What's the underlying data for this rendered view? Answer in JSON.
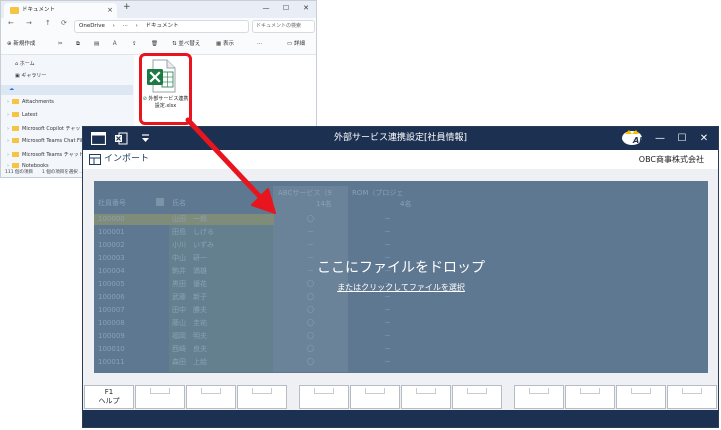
{
  "explorer": {
    "tab_title": "ドキュメント",
    "tab_close": "×",
    "new_tab": "+",
    "win_min": "—",
    "win_max": "☐",
    "win_close": "✕",
    "nav": {
      "back": "←",
      "forward": "→",
      "up": "↑",
      "refresh": "⟳"
    },
    "path": {
      "service": "OneDrive",
      "more": "···",
      "folder": "ドキュメント",
      "sep": "›"
    },
    "search_placeholder": "ドキュメントの検索",
    "toolbar": {
      "new": "新規作成",
      "sort": "並べ替え",
      "view": "表示",
      "details": "詳細"
    },
    "sidebar": [
      {
        "label": "ホーム"
      },
      {
        "label": "ギャラリー"
      },
      {
        "label": "Attachments"
      },
      {
        "label": "Latest"
      },
      {
        "label": "Microsoft Copilot チャット ファ"
      },
      {
        "label": "Microsoft Teams Chat Files"
      },
      {
        "label": "Microsoft Teams チャット ファ"
      },
      {
        "label": "Notebooks"
      }
    ],
    "status": "111 個の項目　　1 個の項目を選択 ...",
    "file": {
      "name": "外部サービス連携設定.xlsx",
      "icon": "excel-file-icon"
    }
  },
  "app": {
    "title": "外部サービス連携設定[社員情報]",
    "win_min": "—",
    "win_max": "☐",
    "win_close": "✕",
    "import_label": "インポート",
    "company": "OBC商事株式会社",
    "grid": {
      "headers": {
        "emp_no": "社員番号",
        "name": "氏名",
        "abc": "ABCサービス（9",
        "abc_count": "14名",
        "rom": "ROM（プロジェ",
        "rom_count": "4名"
      },
      "rows": [
        {
          "no": "100000",
          "name": "山田　一郎",
          "abc": "〇",
          "rom": "－"
        },
        {
          "no": "100001",
          "name": "田島　しげる",
          "abc": "－",
          "rom": "－"
        },
        {
          "no": "100002",
          "name": "小川　いずみ",
          "abc": "－",
          "rom": "－"
        },
        {
          "no": "100003",
          "name": "中山　研一",
          "abc": "－",
          "rom": "－"
        },
        {
          "no": "100004",
          "name": "駒井　満雄",
          "abc": "－",
          "rom": "－"
        },
        {
          "no": "100005",
          "name": "黒田　優花",
          "abc": "〇",
          "rom": "－"
        },
        {
          "no": "100006",
          "name": "武藤　新子",
          "abc": "〇",
          "rom": "－"
        },
        {
          "no": "100007",
          "name": "田中　勝夫",
          "abc": "〇",
          "rom": "－"
        },
        {
          "no": "100008",
          "name": "藤山　圭祐",
          "abc": "〇",
          "rom": "－"
        },
        {
          "no": "100009",
          "name": "福岡　明夫",
          "abc": "〇",
          "rom": "－"
        },
        {
          "no": "100010",
          "name": "西崎　良夫",
          "abc": "〇",
          "rom": "－"
        },
        {
          "no": "100011",
          "name": "森田　上絵",
          "abc": "〇",
          "rom": "－"
        }
      ]
    },
    "drop_main": "ここにファイルをドロップ",
    "drop_sub": "またはクリックしてファイルを選択",
    "fkeys": [
      {
        "key": "F1",
        "label": "ヘルプ"
      }
    ],
    "colors": {
      "titlebar": "#1c3151",
      "overlay": "#5e7891",
      "accent_red": "#e8141e",
      "excel_green": "#1d7a45"
    }
  }
}
